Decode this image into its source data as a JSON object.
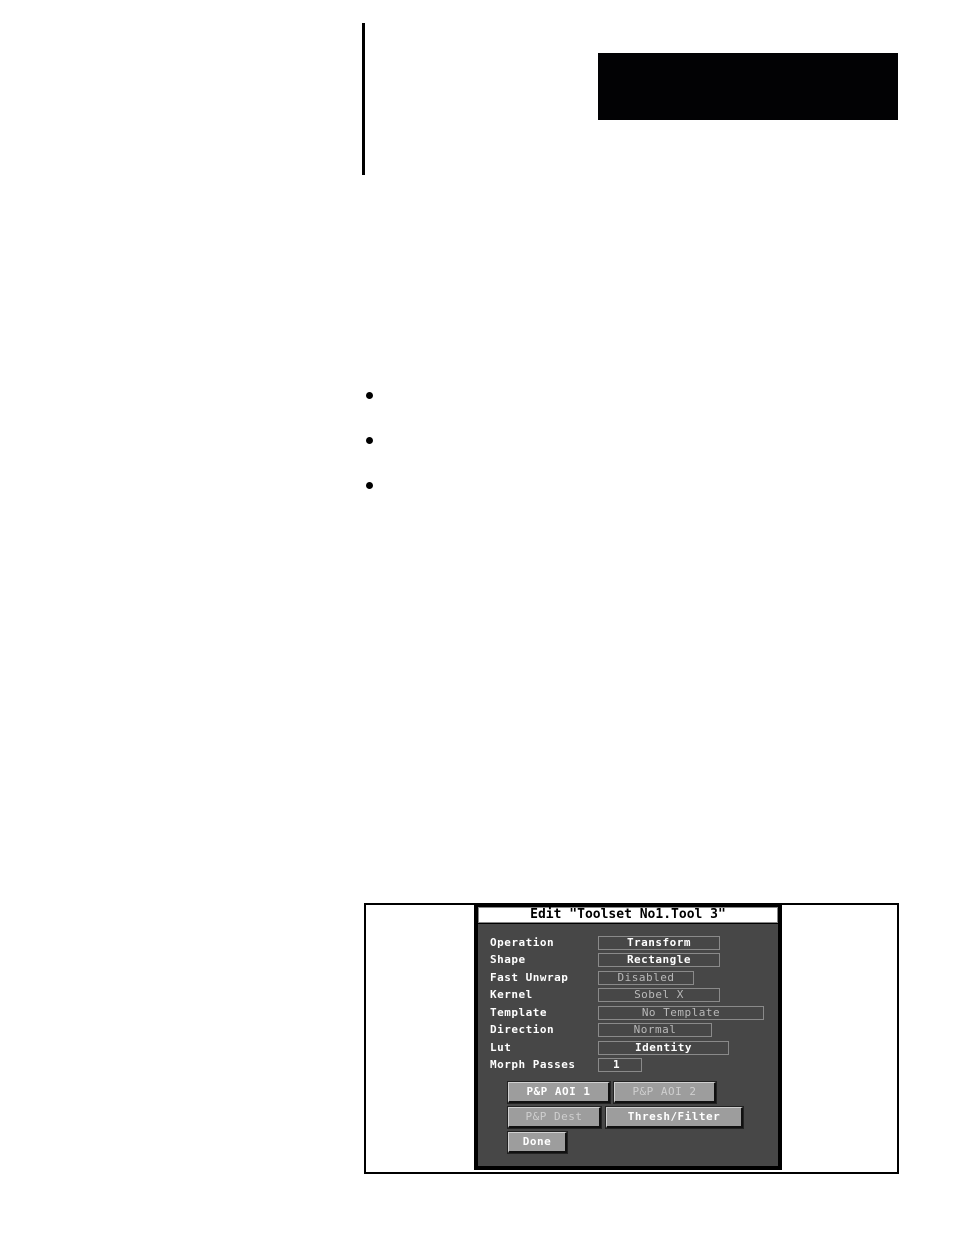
{
  "page": {
    "bullets": [
      "",
      "",
      ""
    ]
  },
  "dialog": {
    "title": "Edit \"Toolset No1.Tool 3\"",
    "fields": [
      {
        "label": "Operation",
        "value": "Transform",
        "enabled": true
      },
      {
        "label": "Shape",
        "value": "Rectangle",
        "enabled": true
      },
      {
        "label": "Fast Unwrap",
        "value": "Disabled",
        "enabled": false
      },
      {
        "label": "Kernel",
        "value": "Sobel X",
        "enabled": false
      },
      {
        "label": "Template",
        "value": "No Template",
        "enabled": false
      },
      {
        "label": "Direction",
        "value": "Normal",
        "enabled": false
      },
      {
        "label": "Lut",
        "value": "Identity",
        "enabled": true
      },
      {
        "label": "Morph Passes",
        "value": "1",
        "enabled": true
      }
    ],
    "buttons": {
      "pp_aoi_1": {
        "label": "P&P AOI 1",
        "enabled": true
      },
      "pp_aoi_2": {
        "label": "P&P AOI 2",
        "enabled": false
      },
      "pp_dest": {
        "label": "P&P Dest",
        "enabled": false
      },
      "thresh_filter": {
        "label": "Thresh/Filter",
        "enabled": true
      },
      "done": {
        "label": "Done",
        "enabled": true
      }
    }
  }
}
